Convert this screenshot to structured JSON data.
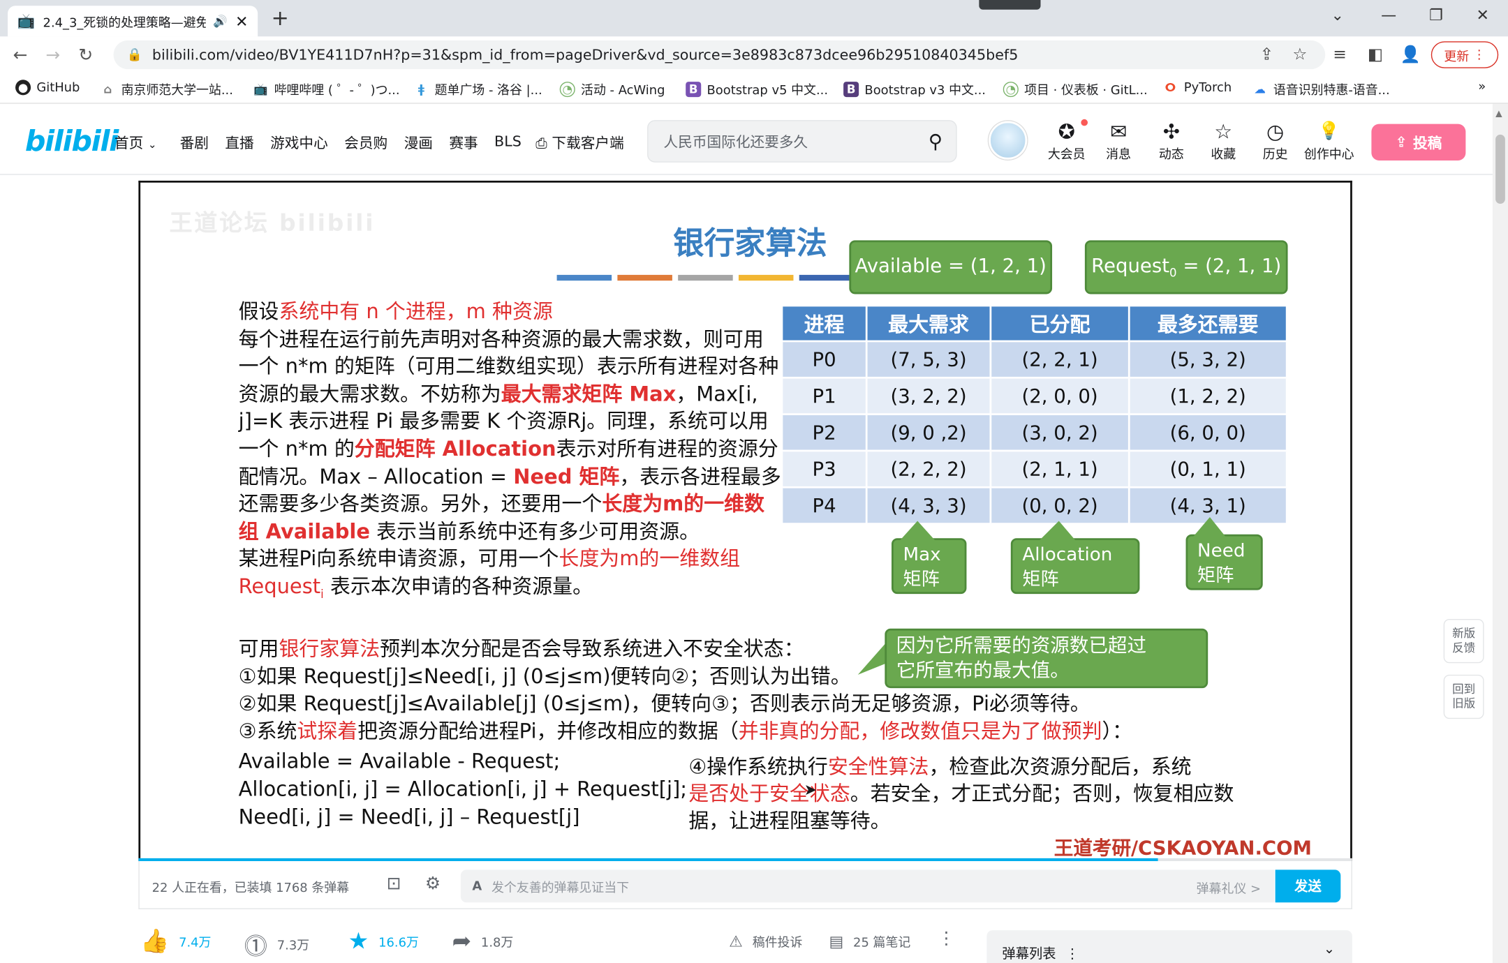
{
  "browser": {
    "tab_title": "2.4_3_死锁的处理策略—避免",
    "url": "bilibili.com/video/BV1YE411D7nH?p=31&spm_id_from=pageDriver&vd_source=3e8983c873dcee96b29510840345bef5",
    "update_label": "更新",
    "bookmarks": [
      "GitHub",
      "南京师范大学一站...",
      "哔哩哔哩 ( ゜- ゜)つ...",
      "题单广场 - 洛谷 |...",
      "活动 - AcWing",
      "Bootstrap v5 中文...",
      "Bootstrap v3 中文...",
      "项目 · 仪表板 · GitL...",
      "PyTorch",
      "语音识别特惠-语音..."
    ],
    "more": "»"
  },
  "site": {
    "logo": "bilibili",
    "nav": [
      "首页",
      "番剧",
      "直播",
      "游戏中心",
      "会员购",
      "漫画",
      "赛事",
      "BLS",
      "下载客户端"
    ],
    "search_placeholder": "人民币国际化还要多久",
    "icons": [
      {
        "label": "大会员",
        "glyph": "✪"
      },
      {
        "label": "消息",
        "glyph": "✉"
      },
      {
        "label": "动态",
        "glyph": "✣"
      },
      {
        "label": "收藏",
        "glyph": "☆"
      },
      {
        "label": "历史",
        "glyph": "◷"
      },
      {
        "label": "创作中心",
        "glyph": "💡"
      }
    ],
    "upload": "投稿"
  },
  "slide": {
    "watermark": "王道论坛 bilibili",
    "title": "银行家算法",
    "available": "Available = (1, 2, 1)",
    "request_pre": "Request",
    "request_sub": "0",
    "request_post": " = (2, 1, 1)",
    "table": {
      "headers": [
        "进程",
        "最大需求",
        "已分配",
        "最多还需要"
      ],
      "rows": [
        [
          "P0",
          "(7, 5, 3)",
          "(2, 2, 1)",
          "(5, 3, 2)"
        ],
        [
          "P1",
          "(3, 2, 2)",
          "(2, 0, 0)",
          "(1, 2, 2)"
        ],
        [
          "P2",
          "(9, 0 ,2)",
          "(3, 0, 2)",
          "(6, 0, 0)"
        ],
        [
          "P3",
          "(2, 2, 2)",
          "(2, 1, 1)",
          "(0, 1, 1)"
        ],
        [
          "P4",
          "(4, 3, 3)",
          "(0, 0, 2)",
          "(4, 3, 1)"
        ]
      ]
    },
    "callouts": {
      "max": [
        "Max",
        "矩阵"
      ],
      "alloc": [
        "Allocation",
        "矩阵"
      ],
      "need": [
        "Need",
        "矩阵"
      ],
      "reason": [
        "因为它所需要的资源数已超过",
        "它所宣布的最大值。"
      ]
    },
    "para": {
      "p1": "假设",
      "p2": "系统中有 n 个进程，m 种资源",
      "p3": "每个进程在运行前先声明对各种资源的最大需求数，则可用一个 n*m 的矩阵（可用二维数组实现）表示所有进程对各种资源的最大需求数。不妨称为",
      "p4": "最大需求矩阵 Max",
      "p5": "，Max[i, j]=K 表示进程 Pi 最多需要 K 个资源Rj。同理，系统可以用一个 n*m 的",
      "p6": "分配矩阵 Allocation",
      "p7": "表示对所有进程的资源分配情况。Max – Allocation = ",
      "p8": "Need 矩阵",
      "p9": "，表示各进程最多还需要多少各类资源。另外，还要用一个",
      "p10": "长度为m的一维数组 Available",
      "p11": " 表示当前系统中还有多少可用资源。",
      "p12": "某进程Pi向系统申请资源，可用一个",
      "p13": "长度为m的一维数组 Request",
      "p13s": "i",
      "p14": " 表示本次申请的各种资源量。"
    },
    "lines": {
      "l1a": "可用",
      "l1b": "银行家算法",
      "l1c": "预判本次分配是否会导致系统进入不安全状态：",
      "l2": "①如果 Request[j]≤Need[i, j] (0≤j≤m)便转向②；否则认为出错。",
      "l3": "②如果 Request[j]≤Available[j] (0≤j≤m)，便转向③；否则表示尚无足够资源，Pi必须等待。",
      "l4a": "③系统",
      "l4b": "试探着",
      "l4c": "把资源分配给进程Pi，并修改相应的数据（",
      "l4d": "并非真的分配，修改数值只是为了做预判",
      "l4e": "）："
    },
    "eqs": [
      "Available = Available - Request;",
      "Allocation[i, j] = Allocation[i, j] + Request[j];",
      "Need[i, j] = Need[i, j] – Request[j]"
    ],
    "step4": {
      "a": "④操作系统执行",
      "b": "安全性算法",
      "c": "，检查此次资源分配后，系统",
      "d": "是否处于安全状态",
      "e": "。若安全，才正式分配；否则，恢复相应数据，让进程阻塞等待。"
    },
    "brand": "王道考研/CSKAOYAN.COM",
    "progress": 0.84
  },
  "player": {
    "viewers": "22 人正在看，已装填 1768 条弹幕",
    "danmaku_placeholder": "发个友善的弹幕见证当下",
    "etiquette": "弹幕礼仪 >",
    "send": "发送"
  },
  "actions": {
    "like": "7.4万",
    "coin": "7.3万",
    "fav": "16.6万",
    "share": "1.8万",
    "report": "稿件投诉",
    "notes": "25 篇笔记"
  },
  "danmaku_list": "弹幕列表",
  "side": {
    "feedback": [
      "新版",
      "反馈"
    ],
    "old": [
      "回到",
      "旧版"
    ]
  }
}
